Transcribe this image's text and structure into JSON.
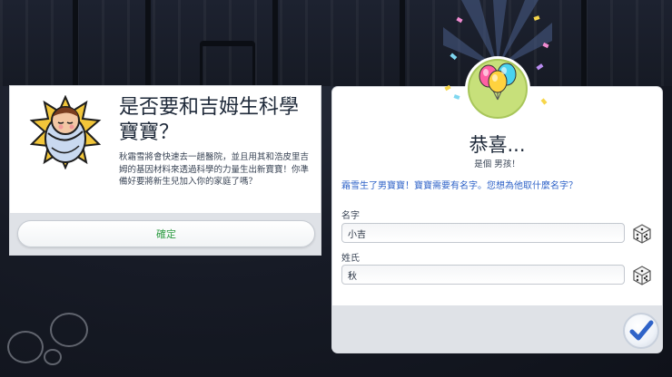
{
  "left_dialog": {
    "title": "是否要和吉姆生科學寶寶？",
    "body": "秋霜雪將會快速去一趟醫院，並且用其和浩皮里吉姆的基因材料來透過科學的力量生出新寶寶！你準備好要將新生兒加入你的家庭了嗎？",
    "confirm_label": "確定",
    "confirm_color": "#2f9d43"
  },
  "right_dialog": {
    "title": "恭喜...",
    "subtitle": "是個 男孩！",
    "prompt": "霜雪生了男寶寶！寶寶需要有名字。您想為他取什麼名字？",
    "prompt_color": "#2f63c8",
    "first_name_label": "名字",
    "first_name_value": "小吉",
    "last_name_label": "姓氏",
    "last_name_value": "秋",
    "confirm_icon": "checkmark-icon",
    "confirm_color": "#2f63c8"
  },
  "icons": {
    "baby": "swaddled-baby-icon",
    "badge": "balloons-icon",
    "dice": "dice-icon"
  }
}
